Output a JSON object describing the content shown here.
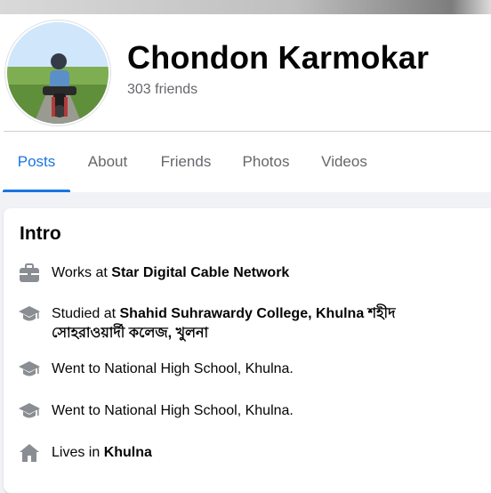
{
  "profile": {
    "name": "Chondon Karmokar",
    "friends": "303 friends"
  },
  "tabs": [
    {
      "label": "Posts",
      "active": true
    },
    {
      "label": "About"
    },
    {
      "label": "Friends"
    },
    {
      "label": "Photos"
    },
    {
      "label": "Videos"
    }
  ],
  "intro": {
    "title": "Intro",
    "items": [
      {
        "icon": "briefcase-icon",
        "prefix": "Works at ",
        "strong": "Star Digital Cable Network"
      },
      {
        "icon": "graduation-cap-icon",
        "prefix": "Studied at ",
        "strong": "Shahid Suhrawardy College, Khulna শহীদ সোহরাওয়ার্দী কলেজ, খুলনা"
      },
      {
        "icon": "graduation-cap-icon",
        "prefix": "Went to National High School, Khulna.",
        "strong": ""
      },
      {
        "icon": "graduation-cap-icon",
        "prefix": "Went to National High School, Khulna.",
        "strong": ""
      },
      {
        "icon": "home-icon",
        "prefix": "Lives in ",
        "strong": "Khulna"
      }
    ]
  },
  "colors": {
    "accent": "#1b74e4",
    "secondary_text": "#65676b",
    "icon": "#8a8d91",
    "page_bg": "#f0f2f5"
  }
}
